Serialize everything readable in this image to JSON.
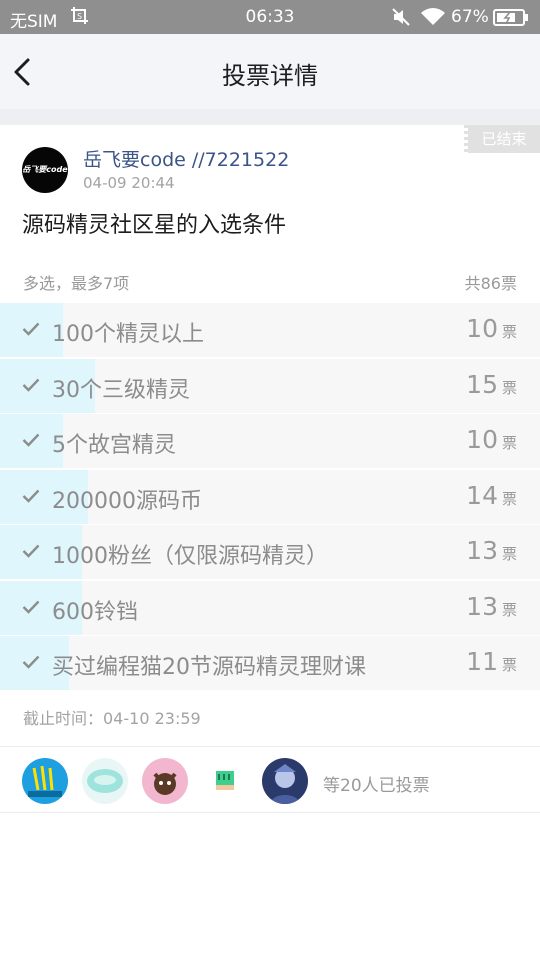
{
  "status_bar": {
    "carrier": "无SIM",
    "time": "06:33",
    "battery": "67%"
  },
  "nav": {
    "title": "投票详情"
  },
  "poll": {
    "status": "已结束",
    "author": "岳飞要code //7221522",
    "avatar_text": "岳飞要code",
    "date": "04-09 20:44",
    "question": "源码精灵社区星的入选条件",
    "mode": "多选，最多7项",
    "total": "共86票",
    "vote_unit": "票",
    "options": [
      {
        "label": "100个精灵以上",
        "votes": "10",
        "share": 0.116
      },
      {
        "label": "30个三级精灵",
        "votes": "15",
        "share": 0.175
      },
      {
        "label": "5个故宫精灵",
        "votes": "10",
        "share": 0.116
      },
      {
        "label": "200000源码币",
        "votes": "14",
        "share": 0.163
      },
      {
        "label": "1000粉丝（仅限源码精灵）",
        "votes": "13",
        "share": 0.151
      },
      {
        "label": "600铃铛",
        "votes": "13",
        "share": 0.151
      },
      {
        "label": "买过编程猫20节源码精灵理财课",
        "votes": "11",
        "share": 0.128
      }
    ],
    "deadline": "截止时间：04-10 23:59",
    "voters_summary": "等20人已投票"
  },
  "colors": {
    "accent_fill": "#dff6fc",
    "author": "#3c5489",
    "status_bar": "#8f8f8f"
  }
}
